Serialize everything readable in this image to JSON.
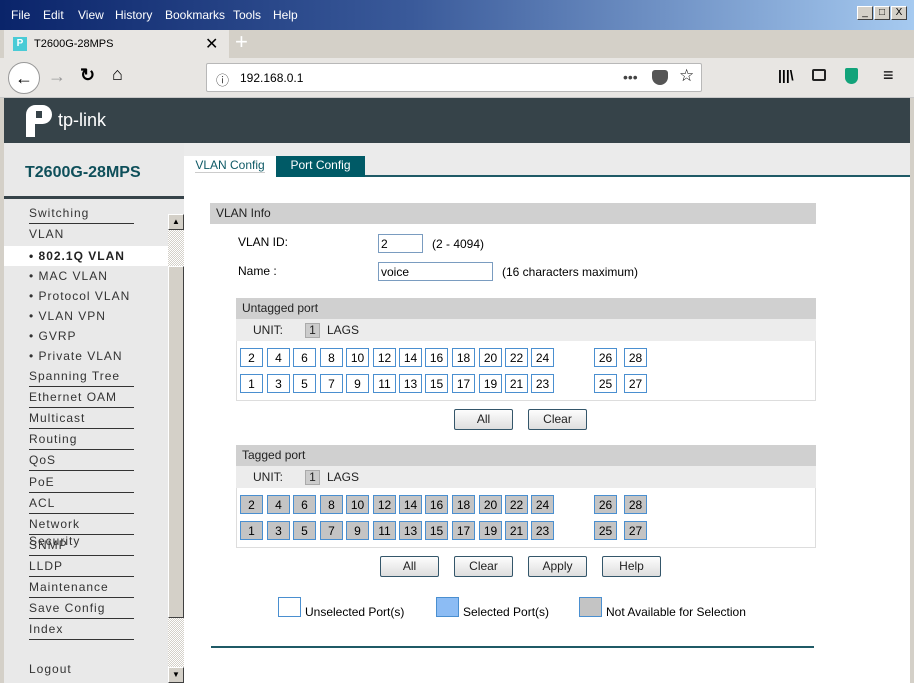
{
  "browser": {
    "menu": [
      "File",
      "Edit",
      "View",
      "History",
      "Bookmarks",
      "Tools",
      "Help"
    ],
    "tab_title": "T2600G-28MPS",
    "url": "192.168.0.1"
  },
  "header": {
    "logo": "tp-link"
  },
  "sidebar": {
    "model": "T2600G-28MPS",
    "items_top": [
      "Switching",
      "VLAN"
    ],
    "sub_items": [
      "802.1Q VLAN",
      "MAC VLAN",
      "Protocol VLAN",
      "VLAN VPN",
      "GVRP",
      "Private VLAN"
    ],
    "active": "802.1Q VLAN",
    "items": [
      "Spanning Tree",
      "Ethernet OAM",
      "Multicast",
      "Routing",
      "QoS",
      "PoE",
      "ACL",
      "Network Security",
      "SNMP",
      "LLDP",
      "Maintenance",
      "Save Config",
      "Index"
    ],
    "logout": "Logout"
  },
  "tabs": [
    {
      "label": "VLAN Config",
      "active": true
    },
    {
      "label": "Port Config",
      "active": false
    }
  ],
  "vlan_info": {
    "title": "VLAN Info",
    "id_label": "VLAN ID:",
    "id_value": "2",
    "id_hint": "(2 - 4094)",
    "name_label": "Name :",
    "name_value": "voice",
    "name_hint": "(16 characters maximum)"
  },
  "untagged": {
    "title": "Untagged port",
    "unit_label": "UNIT:",
    "unit": "1",
    "lags": "LAGS",
    "state": "unselected"
  },
  "tagged": {
    "title": "Tagged port",
    "unit_label": "UNIT:",
    "unit": "1",
    "lags": "LAGS",
    "state": "not-available"
  },
  "ports": {
    "top": [
      "2",
      "4",
      "6",
      "8",
      "10",
      "12",
      "14",
      "16",
      "18",
      "20",
      "22",
      "24",
      "26",
      "28"
    ],
    "bottom": [
      "1",
      "3",
      "5",
      "7",
      "9",
      "11",
      "13",
      "15",
      "17",
      "19",
      "21",
      "23",
      "25",
      "27"
    ]
  },
  "buttons": {
    "all": "All",
    "clear": "Clear",
    "apply": "Apply",
    "help": "Help"
  },
  "legend": {
    "unselected": "Unselected Port(s)",
    "selected": "Selected Port(s)",
    "na": "Not Available for Selection"
  },
  "colors": {
    "header": "#364349",
    "accent": "#005a66",
    "selected": "#8cbcf4",
    "na": "#c4c4c4",
    "port_border": "#4a8fd0"
  }
}
